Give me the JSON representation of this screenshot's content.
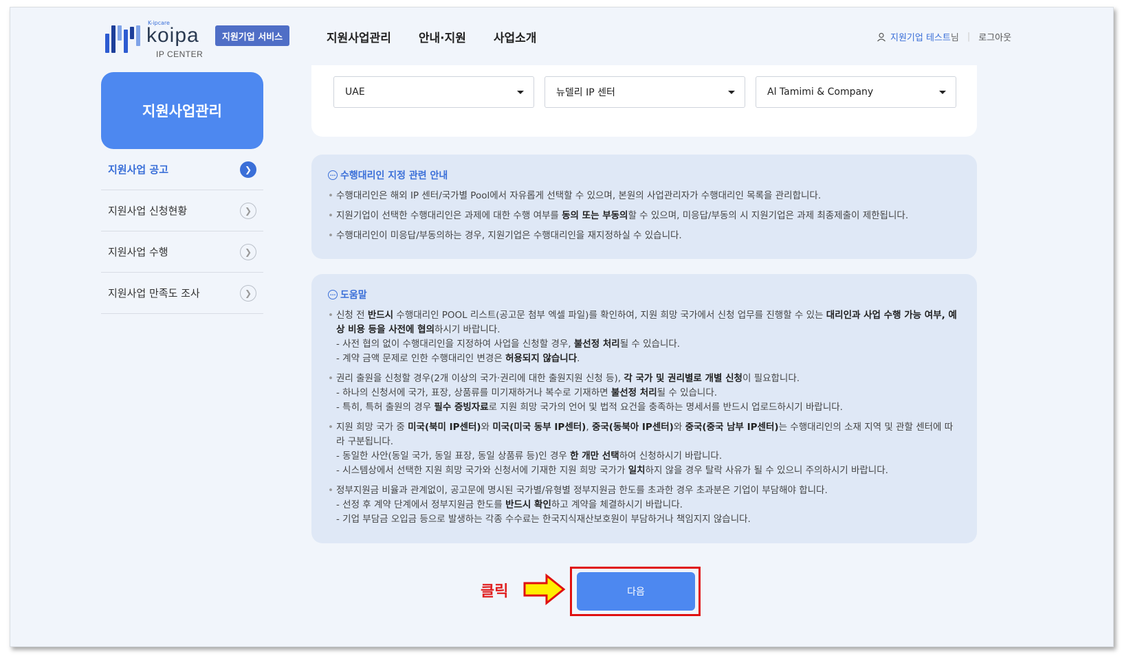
{
  "header": {
    "logo": {
      "kipcare": "K-ipcare",
      "wordmark": "koipa",
      "subtitle": "IP CENTER"
    },
    "service_badge": "지원기업 서비스",
    "nav": [
      "지원사업관리",
      "안내·지원",
      "사업소개"
    ],
    "user": {
      "name": "지원기업 테스트",
      "suffix": "님",
      "logout": "로그아웃"
    }
  },
  "sidebar": {
    "title": "지원사업관리",
    "items": [
      {
        "label": "지원사업 공고",
        "active": true
      },
      {
        "label": "지원사업 신청현황",
        "active": false
      },
      {
        "label": "지원사업 수행",
        "active": false
      },
      {
        "label": "지원사업 만족도 조사",
        "active": false
      }
    ]
  },
  "selects": {
    "country": "UAE",
    "center": "뉴델리 IP 센터",
    "agent": "Al Tamimi & Company"
  },
  "notice": {
    "title": "수행대리인 지정 관련 안내",
    "b1": "수행대리인은 해외 IP 센터/국가별 Pool에서 자유롭게 선택할 수 있으며, 본원의 사업관리자가 수행대리인 목록을 관리합니다.",
    "b2_pre": "지원기업이 선택한 수행대리인은 과제에 대한 수행 여부를 ",
    "b2_bold": "동의 또는 부동의",
    "b2_post": "할 수 있으며, 미응답/부동의 시 지원기업은 과제 최종제출이 제한됩니다.",
    "b3": "수행대리인이 미응답/부동의하는 경우, 지원기업은 수행대리인을 재지정하실 수 있습니다."
  },
  "help": {
    "title": "도움말",
    "g1": {
      "t1": "신청 전 ",
      "b1": "반드시",
      "t2": " 수행대리인 POOL 리스트(공고문 첨부 엑셀 파일)를 확인하여, 지원 희망 국가에서 신청 업무를 진행할 수 있는 ",
      "b2": "대리인과 사업 수행 가능 여부, 예상 비용 등을 사전에 협의",
      "t3": "하시기 바랍니다.",
      "s1_pre": "- 사전 협의 없이 수행대리인을 지정하여 사업을 신청할 경우, ",
      "s1_bold": "불선정 처리",
      "s1_post": "될 수 있습니다.",
      "s2_pre": "- 계약 금액 문제로 인한 수행대리인 변경은 ",
      "s2_bold": "허용되지 않습니다",
      "s2_post": "."
    },
    "g2": {
      "t1": "권리 출원을 신청할 경우(2개 이상의 국가·권리에 대한 출원지원 신청 등), ",
      "b1": "각 국가 및 권리별로 개별 신청",
      "t2": "이 필요합니다.",
      "s1_pre": "- 하나의 신청서에 국가, 표장, 상품류를 미기재하거나 복수로 기재하면 ",
      "s1_bold": "불선정 처리",
      "s1_post": "될 수 있습니다.",
      "s2_pre": "- 특히, 특허 출원의 경우 ",
      "s2_bold": "필수 증빙자료",
      "s2_post": "로 지원 희망 국가의 언어 및 법적 요건을 충족하는 명세서를 반드시 업로드하시기 바랍니다."
    },
    "g3": {
      "t1": "지원 희망 국가 중 ",
      "b1": "미국(북미 IP센터)",
      "t2": "와 ",
      "b2": "미국(미국 동부 IP센터)",
      "t3": ", ",
      "b3": "중국(동북아 IP센터)",
      "t4": "와 ",
      "b4": "중국(중국 남부 IP센터)",
      "t5": "는 수행대리인의 소재 지역 및 관할 센터에 따라 구분됩니다.",
      "s1_pre": "- 동일한 사안(동일 국가, 동일 표장, 동일 상품류 등)인 경우 ",
      "s1_bold": "한 개만 선택",
      "s1_post": "하여 신청하시기 바랍니다.",
      "s2_pre": "- 시스템상에서 선택한 지원 희망 국가와 신청서에 기재한 지원 희망 국가가 ",
      "s2_bold": "일치",
      "s2_post": "하지 않을 경우 탈락 사유가 될 수 있으니 주의하시기 바랍니다."
    },
    "g4": {
      "t1": "정부지원금 비율과 관계없이, 공고문에 명시된 국가별/유형별 정부지원금 한도를 초과한 경우 초과분은 기업이 부담해야 합니다.",
      "s1_pre": "- 선정 후 계약 단계에서 정부지원금 한도를 ",
      "s1_bold": "반드시 확인",
      "s1_post": "하고 계약을 체결하시기 바랍니다.",
      "s2": "- 기업 부담금 오입금 등으로 발생하는 각종 수수료는 한국지식재산보호원이 부담하거나 책임지지 않습니다."
    }
  },
  "annotation": {
    "label": "클릭"
  },
  "next_button": "다음",
  "colors": {
    "primary": "#4d88f0",
    "badge": "#4f6ec6",
    "highlight": "#e01010",
    "arrow": "#ffee00"
  }
}
